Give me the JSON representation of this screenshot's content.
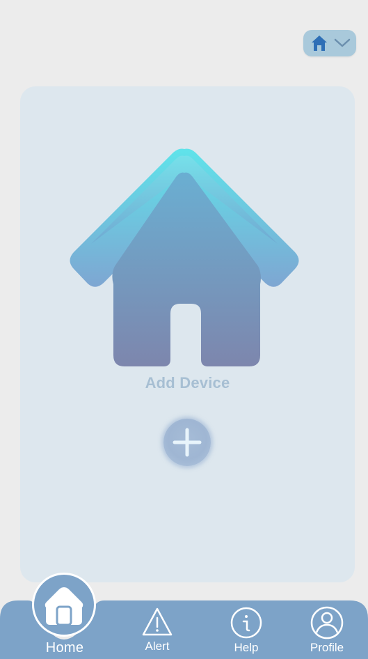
{
  "header": {
    "home_selector": {
      "icon": "home-icon",
      "dropdown_icon": "chevron-down-icon",
      "bg_color": "#a9c9db",
      "icon_color": "#2f6fb6"
    }
  },
  "card": {
    "hero_icon": "house-icon",
    "add_device_label": "Add Device",
    "add_button_icon": "plus-icon"
  },
  "nav": {
    "bar_color": "#7da3c8",
    "items": [
      {
        "label": "Home",
        "icon": "home-icon",
        "active": true
      },
      {
        "label": "Alert",
        "icon": "alert-triangle-icon",
        "active": false
      },
      {
        "label": "Help",
        "icon": "info-icon",
        "active": false
      },
      {
        "label": "Profile",
        "icon": "user-icon",
        "active": false
      }
    ]
  }
}
